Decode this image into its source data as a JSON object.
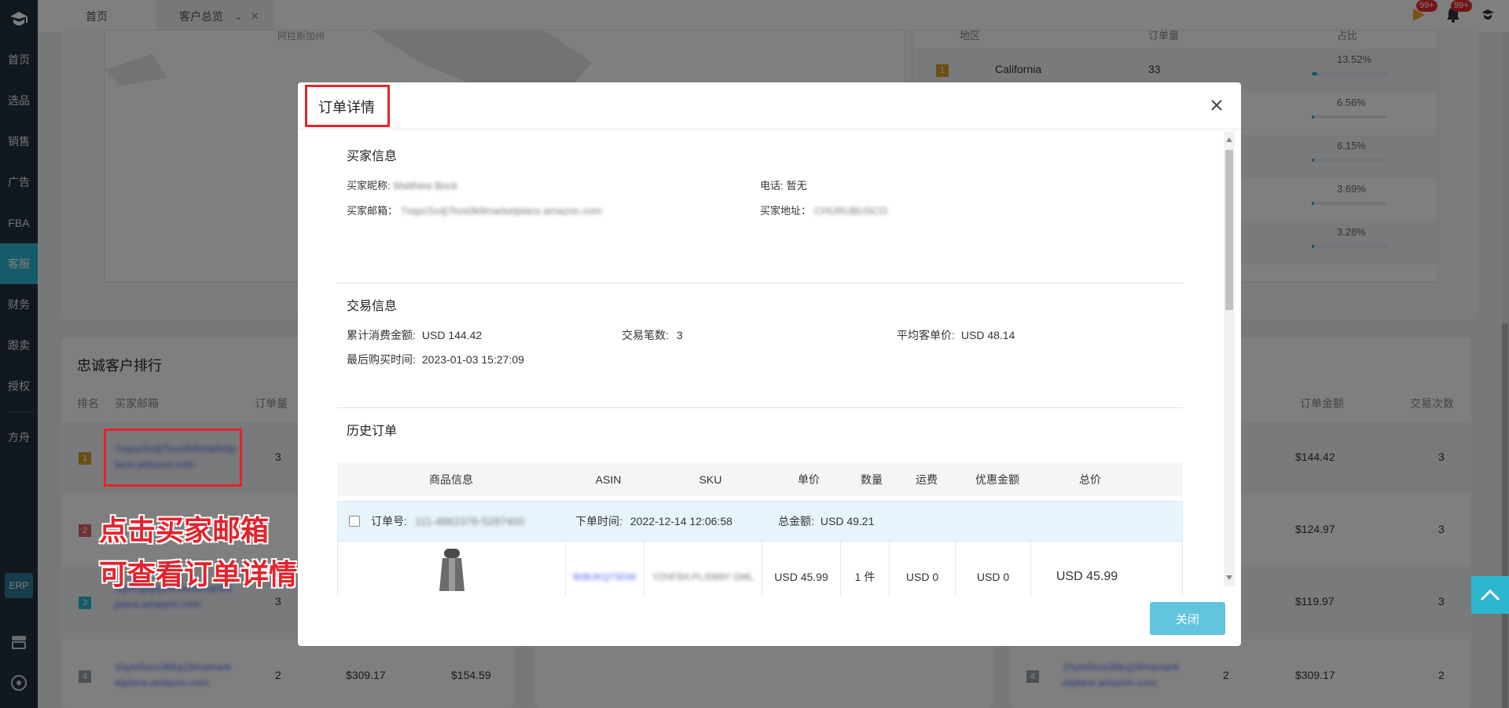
{
  "sidebar": {
    "items": [
      {
        "label": "首页"
      },
      {
        "label": "选品"
      },
      {
        "label": "销售"
      },
      {
        "label": "广告"
      },
      {
        "label": "FBA"
      },
      {
        "label": "客服",
        "active": true
      },
      {
        "label": "财务"
      },
      {
        "label": "跟卖"
      },
      {
        "label": "授权"
      },
      {
        "label": "方舟"
      }
    ],
    "erp_label": "ERP"
  },
  "topbar": {
    "tabs": [
      {
        "label": "首页"
      },
      {
        "label": "客户总览"
      }
    ],
    "flag_badge": "99+",
    "bell_badge": "99+"
  },
  "background": {
    "map_caption": "阿拉斯加州",
    "region_header": {
      "region": "地区",
      "orders": "订单量",
      "ratio": "占比"
    },
    "regions": [
      {
        "rank": "1",
        "name": "California",
        "orders": "33",
        "pct_text": "13.52%",
        "pct": 0.1352
      },
      {
        "rank": "",
        "name": "",
        "orders": "",
        "pct_text": "6.56%",
        "pct": 0.0656
      },
      {
        "rank": "",
        "name": "",
        "orders": "",
        "pct_text": "6.15%",
        "pct": 0.0615
      },
      {
        "rank": "",
        "name": "",
        "orders": "",
        "pct_text": "3.69%",
        "pct": 0.0369
      },
      {
        "rank": "",
        "name": "",
        "orders": "",
        "pct_text": "3.28%",
        "pct": 0.0328
      }
    ],
    "loyal": {
      "title": "忠诚客户排行",
      "col_rank": "排名",
      "col_email": "买家邮箱",
      "col_orders": "订单量",
      "col_amount": "订单金额",
      "col_times": "交易次数",
      "rows": [
        {
          "rank": "1",
          "email": "7nqsc5xdj7hvs0k8marketplace.amazon.com",
          "orders": "3",
          "amount": "$144.42",
          "times": "3"
        },
        {
          "rank": "2",
          "email": "",
          "orders": "",
          "amount": "$124.97",
          "times": "3"
        },
        {
          "rank": "3",
          "email": "rtgsmgsjupo65w68marketplace.amazon.com",
          "orders": "3",
          "amount": "$119.97",
          "times": "3"
        },
        {
          "rank": "4",
          "email": "1hytx6sns3bkq18mamarketplace.amazon.com",
          "orders": "2",
          "total": "$309.17",
          "avg": "$154.59",
          "amount": "$309.17",
          "times": "2"
        }
      ]
    }
  },
  "annotation": {
    "line1": "点击买家邮箱",
    "line2": "可查看订单详情"
  },
  "modal": {
    "title": "订单详情",
    "buyer": {
      "section_title": "买家信息",
      "nickname_label": "买家昵称:",
      "nickname": "Matthew Bock",
      "phone_label": "电话:",
      "phone": "暂无",
      "email_label": "买家邮箱：",
      "email": "7nqsc5xdj7hvs0k8marketplace.amazon.com",
      "address_label": "买家地址：",
      "address": "CHURUBUSCO"
    },
    "trade": {
      "section_title": "交易信息",
      "total_label": "累计消费金额:",
      "total": "USD  144.42",
      "count_label": "交易笔数:",
      "count": "3",
      "avg_label": "平均客单价:",
      "avg": "USD  48.14",
      "last_label": "最后购买时间:",
      "last": "2023-01-03 15:27:09"
    },
    "history": {
      "section_title": "历史订单",
      "columns": [
        "商品信息",
        "ASIN",
        "SKU",
        "单价",
        "数量",
        "运费",
        "优惠金额",
        "总价"
      ],
      "order": {
        "order_no_label": "订单号:",
        "order_no": "111-4862376-5287400",
        "time_label": "下单时间:",
        "time": "2022-12-14 12:06:58",
        "amount_label": "总金额:",
        "amount": "USD 49.21"
      },
      "item": {
        "asin": "B0BJKQ73GW",
        "sku": "YZHFBA PL3089Y GML",
        "price": "USD  45.99",
        "qty": "1 件",
        "shipping": "USD 0",
        "discount": "USD 0",
        "total": "USD 45.99"
      }
    },
    "close_label": "关闭"
  }
}
